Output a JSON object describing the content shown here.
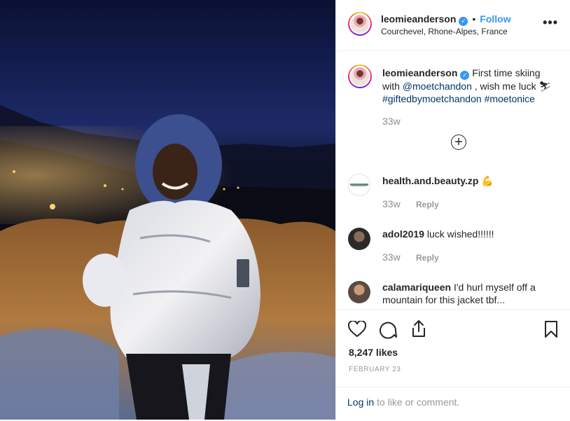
{
  "post": {
    "username": "leomieanderson",
    "follow_label": "Follow",
    "separator": "•",
    "location": "Courchevel, Rhone-Alpes, France",
    "more_label": "•••"
  },
  "caption": {
    "username": "leomieanderson",
    "text_before": "First time skiing with",
    "mention": "@moetchandon",
    "text_after": ", wish me luck",
    "emoji": "⛷",
    "hashtag1": "#giftedbymoetchandon",
    "hashtag2": "#moetonice",
    "time": "33w",
    "load_more": "+"
  },
  "comments": [
    {
      "username": "health.and.beauty.zp",
      "text": "💪",
      "time": "33w",
      "reply": "Reply"
    },
    {
      "username": "adol2019",
      "text": "luck wished!!!!!!",
      "time": "33w",
      "reply": "Reply"
    },
    {
      "username": "calamariqueen",
      "text": "I'd hurl myself off a mountain for this jacket tbf...",
      "time": "",
      "reply": ""
    }
  ],
  "stats": {
    "likes": "8,247 likes",
    "date": "FEBRUARY 23"
  },
  "login": {
    "link": "Log in",
    "rest": " to like or comment."
  },
  "icons": {
    "like": "heart-icon",
    "comment": "comment-icon",
    "share": "share-icon",
    "save": "bookmark-icon"
  },
  "colors": {
    "link_blue": "#3897f0",
    "text": "#262626",
    "muted": "#8e8e8e",
    "hashtag": "#003569"
  }
}
